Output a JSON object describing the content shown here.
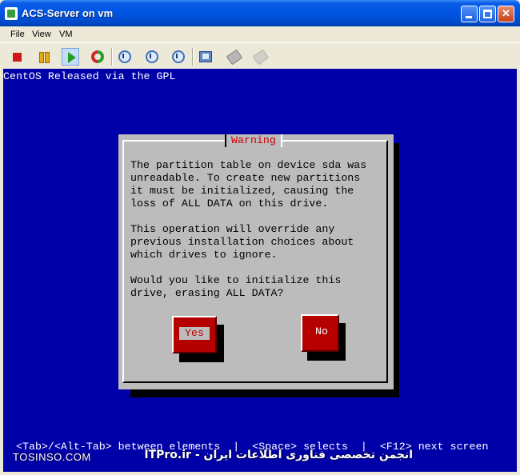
{
  "window": {
    "title": "ACS-Server on vm",
    "icon": "vm-app-icon",
    "controls": [
      "minimize-icon",
      "maximize-icon",
      "close-icon"
    ]
  },
  "menu": {
    "items": [
      {
        "label": "File"
      },
      {
        "label": "View"
      },
      {
        "label": "VM"
      }
    ]
  },
  "toolbar": {
    "buttons": [
      {
        "icon": "stop-icon",
        "color": "#d01818"
      },
      {
        "icon": "pause-icon",
        "color": "#e8a812"
      },
      {
        "icon": "play-icon",
        "color": "#22a022"
      },
      {
        "icon": "reset-icon"
      },
      {
        "icon": "snapshot-icon"
      },
      {
        "icon": "revert-snapshot-icon"
      },
      {
        "icon": "snapshot-manager-icon"
      },
      {
        "icon": "preferences-icon"
      },
      {
        "icon": "vmware-tools-icon"
      },
      {
        "icon": "vmware-tools-disabled-icon"
      }
    ]
  },
  "console": {
    "background": "#0000a8",
    "top_line": "CentOS Released via the GPL",
    "dialog": {
      "title": "Warning",
      "paragraph1": "The partition table on device sda was\nunreadable. To create new partitions\nit must be initialized, causing the\nloss of ALL DATA on this drive.",
      "paragraph2": "This operation will override any\nprevious installation choices about\nwhich drives to ignore.",
      "paragraph3": "Would you like to initialize this\ndrive, erasing ALL DATA?",
      "yes_label": "Yes",
      "no_label": "No"
    },
    "bottom_line": "<Tab>/<Alt-Tab> between elements  |  <Space> selects  |  <F12> next screen"
  },
  "watermark": {
    "left": "TOSINSO.COM",
    "right": "انجمن تخصصی فناوری اطلاعات ایران - ITPro.ir"
  }
}
